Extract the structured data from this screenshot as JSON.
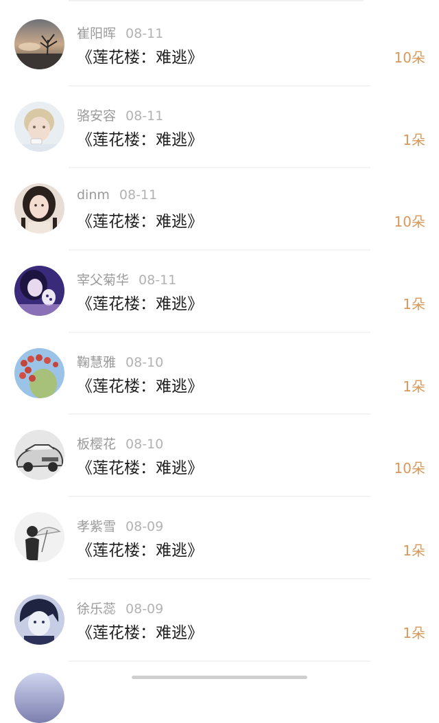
{
  "rows": [
    {
      "name": "崔阳晖",
      "date": "08-11",
      "title": "《莲花楼：难逃》",
      "amount": "10朵",
      "avatar_icon": "sunset-tree-avatar"
    },
    {
      "name": "骆安容",
      "date": "08-11",
      "title": "《莲花楼：难逃》",
      "amount": "1朵",
      "avatar_icon": "young-man-portrait-avatar"
    },
    {
      "name": "dinm",
      "date": "08-11",
      "title": "《莲花楼：难逃》",
      "amount": "10朵",
      "avatar_icon": "girl-portrait-avatar"
    },
    {
      "name": "宰父菊华",
      "date": "08-11",
      "title": "《莲花楼：难逃》",
      "amount": "1朵",
      "avatar_icon": "purple-anime-avatar"
    },
    {
      "name": "鞠慧雅",
      "date": "08-10",
      "title": "《莲花楼：难逃》",
      "amount": "1朵",
      "avatar_icon": "cactus-fruit-avatar"
    },
    {
      "name": "板樱花",
      "date": "08-10",
      "title": "《莲花楼：难逃》",
      "amount": "10朵",
      "avatar_icon": "vintage-car-avatar"
    },
    {
      "name": "孝紫雪",
      "date": "08-09",
      "title": "《莲花楼：难逃》",
      "amount": "1朵",
      "avatar_icon": "umbrella-figure-avatar"
    },
    {
      "name": "徐乐蕊",
      "date": "08-09",
      "title": "《莲花楼：难逃》",
      "amount": "1朵",
      "avatar_icon": "anime-boy-avatar"
    }
  ],
  "colors": {
    "amount": "#d9975a",
    "name": "#9a9a9a",
    "title": "#1f1f1f"
  }
}
